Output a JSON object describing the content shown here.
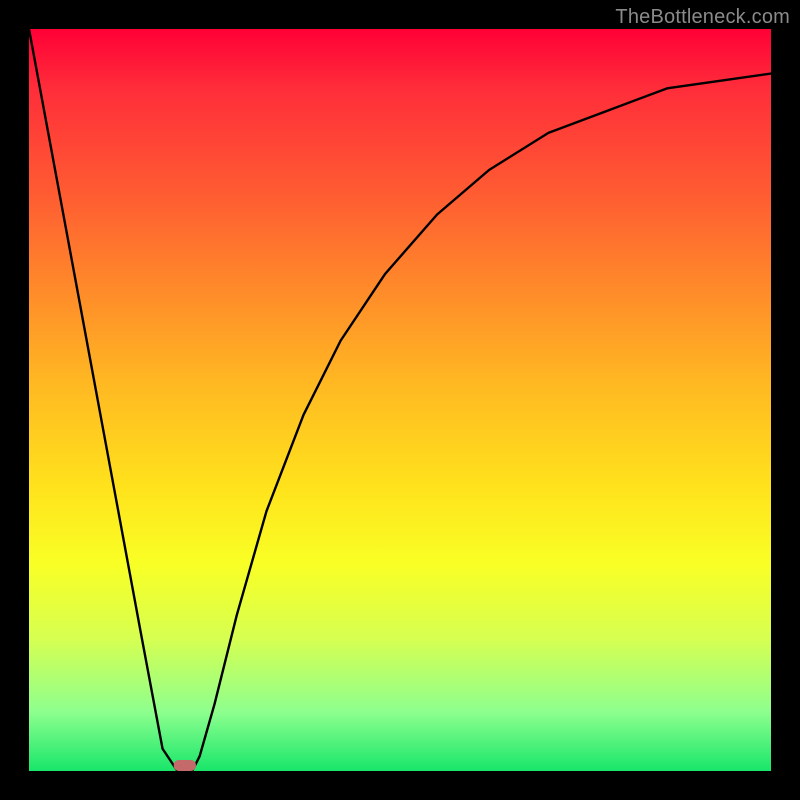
{
  "attribution": "TheBottleneck.com",
  "colors": {
    "frame": "#000000",
    "gradient_top": "#ff0036",
    "gradient_bottom": "#18e66a",
    "curve": "#000000",
    "marker": "#c46a6a"
  },
  "chart_data": {
    "type": "line",
    "title": "",
    "xlabel": "",
    "ylabel": "",
    "xlim": [
      0,
      100
    ],
    "ylim": [
      0,
      100
    ],
    "grid": false,
    "legend": false,
    "series": [
      {
        "name": "bottleneck_curve",
        "x": [
          0,
          5,
          10,
          15,
          18,
          20,
          21,
          22,
          23,
          25,
          28,
          32,
          37,
          42,
          48,
          55,
          62,
          70,
          78,
          86,
          93,
          100
        ],
        "values": [
          100,
          73,
          46,
          19,
          3,
          0,
          0,
          0,
          2,
          9,
          21,
          35,
          48,
          58,
          67,
          75,
          81,
          86,
          89,
          92,
          93,
          94
        ]
      }
    ],
    "annotations": [
      {
        "name": "optimal_marker",
        "x_range": [
          19.5,
          22.5
        ],
        "y": 0
      }
    ]
  }
}
